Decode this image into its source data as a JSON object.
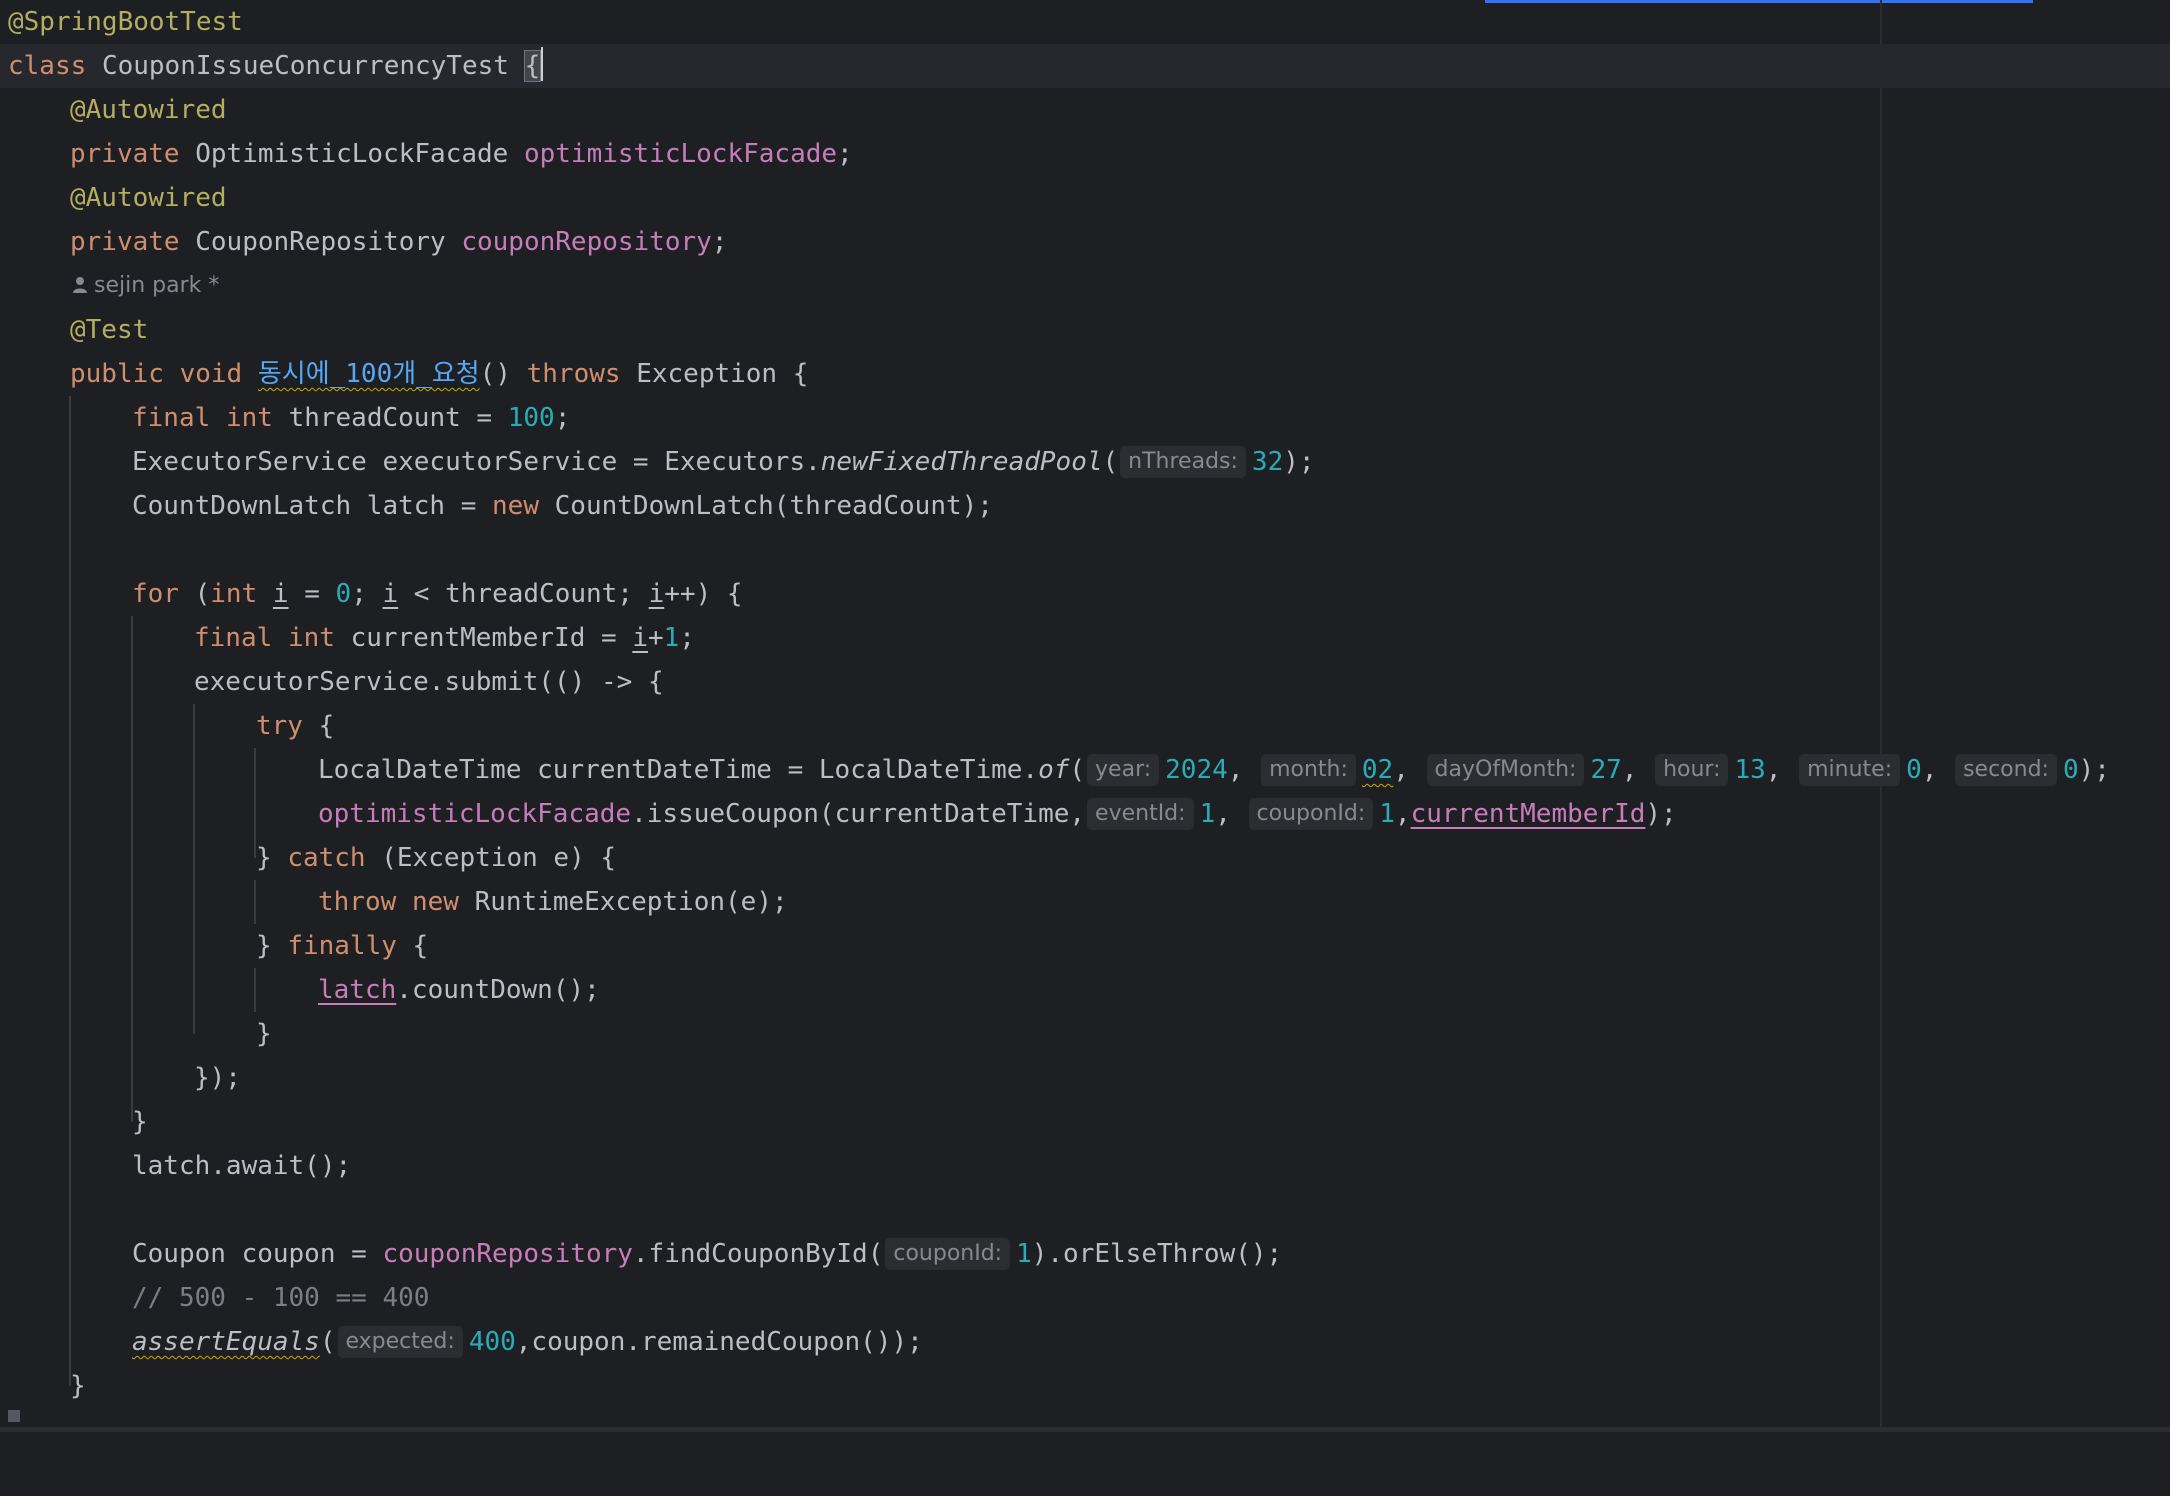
{
  "editor": {
    "author_hint": "sejin park *",
    "lines": {
      "l1": {
        "annotation": "@SpringBootTest"
      },
      "l2": {
        "kw": "class",
        "name": "CouponIssueConcurrencyTest",
        "brace": "{"
      },
      "l3": {
        "annotation": "@Autowired"
      },
      "l4": {
        "kw": "private",
        "type": "OptimisticLockFacade",
        "field": "optimisticLockFacade",
        "end": ";"
      },
      "l5": {
        "annotation": "@Autowired"
      },
      "l6": {
        "kw": "private",
        "type": "CouponRepository",
        "field": "couponRepository",
        "end": ";"
      },
      "l8": {
        "annotation": "@Test"
      },
      "l9": {
        "kw1": "public",
        "kw2": "void",
        "method": "동시에_100개_요청",
        "paren": "()",
        "kw3": "throws",
        "rest": "Exception {"
      },
      "l10": {
        "kw1": "final",
        "kw2": "int",
        "text": "threadCount = ",
        "num": "100",
        "end": ";"
      },
      "l11": {
        "text": "ExecutorService executorService = Executors.",
        "call": "newFixedThreadPool",
        "open": "(",
        "hint": "nThreads:",
        "num": "32",
        "end": ");"
      },
      "l12": {
        "text": "CountDownLatch latch = ",
        "kw": "new",
        "rest": "CountDownLatch(threadCount);"
      },
      "l14": {
        "kw1": "for",
        "a": "(",
        "kw2": "int",
        "b": " ",
        "i1": "i",
        "c": " = ",
        "num": "0",
        "d": "; ",
        "i2": "i",
        "e": " < threadCount; ",
        "i3": "i",
        "f": "++) {"
      },
      "l15": {
        "kw1": "final",
        "kw2": "int",
        "text": "currentMemberId = ",
        "i": "i",
        "plus": "+",
        "num": "1",
        "end": ";"
      },
      "l16": {
        "text": "executorService.submit(() -> {"
      },
      "l17": {
        "kw": "try",
        "rest": "{"
      },
      "l18": {
        "text": "LocalDateTime currentDateTime = LocalDateTime.",
        "call": "of",
        "open": "(",
        "h1": "year:",
        "v1": "2024",
        "s1": ",",
        "h2": "month:",
        "v2": "02",
        "s2": ",",
        "h3": "dayOfMonth:",
        "v3": "27",
        "s3": ",",
        "h4": "hour:",
        "v4": "13",
        "s4": ",",
        "h5": "minute:",
        "v5": "0",
        "s5": ",",
        "h6": "second:",
        "v6": "0",
        "end": ");"
      },
      "l19": {
        "field": "optimisticLockFacade",
        "text": ".issueCoupon(currentDateTime,",
        "h1": "eventId:",
        "v1": "1",
        "s1": ",",
        "h2": "couponId:",
        "v2": "1",
        "s2": ",",
        "var": "currentMemberId",
        "end": ");"
      },
      "l20": {
        "a": "} ",
        "kw": "catch",
        "rest": "(Exception e) {"
      },
      "l21": {
        "kw1": "throw",
        "kw2": "new",
        "rest": "RuntimeException(e);"
      },
      "l22": {
        "a": "} ",
        "kw": "finally",
        "rest": "{"
      },
      "l23": {
        "field": "latch",
        "rest": ".countDown();"
      },
      "l24": {
        "text": "}"
      },
      "l25": {
        "text": "});"
      },
      "l26": {
        "text": "}"
      },
      "l27": {
        "text": "latch.await();"
      },
      "l29": {
        "text": "Coupon coupon = ",
        "field": "couponRepository",
        "call": ".findCouponById(",
        "hint": "couponId:",
        "num": "1",
        "end": ").orElseThrow();"
      },
      "l30": {
        "comment": "// 500 - 100 == 400"
      },
      "l31": {
        "call": "assertEquals",
        "open": "(",
        "hint": "expected:",
        "num": "400",
        "end": ",coupon.remainedCoupon());"
      },
      "l32": {
        "text": "}"
      }
    }
  },
  "colors": {
    "background": "#1e1f22",
    "current_line": "#26282e",
    "keyword": "#cf8e6d",
    "annotation": "#b3ae60",
    "field": "#c77dbb",
    "number": "#2aacb8",
    "comment": "#7a7e85",
    "default_text": "#bcbec4",
    "inlay_hint_bg": "#2b2d30",
    "progress_bar": "#3574f0"
  },
  "icons": {
    "author": "person-icon"
  }
}
